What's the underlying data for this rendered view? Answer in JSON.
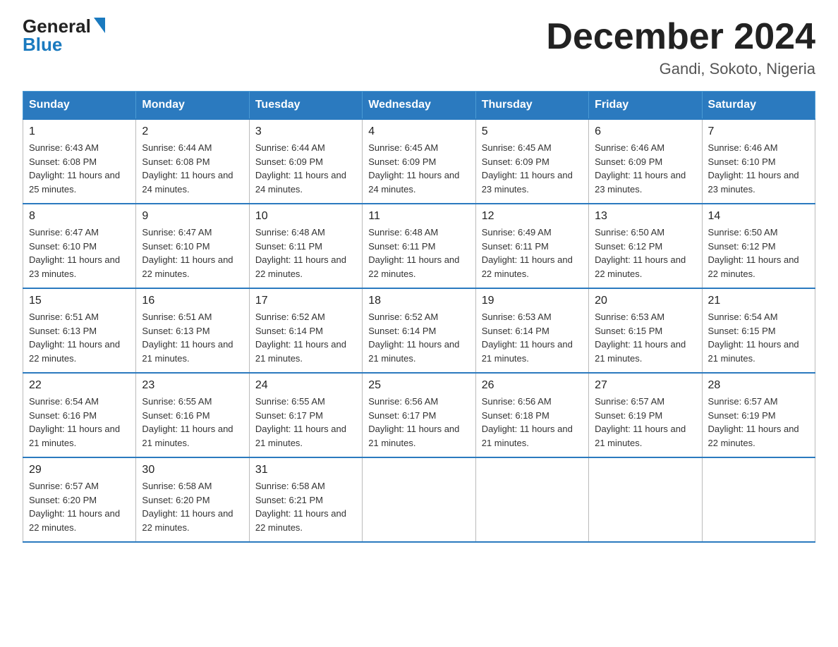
{
  "logo": {
    "general": "General",
    "blue": "Blue"
  },
  "header": {
    "month": "December 2024",
    "location": "Gandi, Sokoto, Nigeria"
  },
  "days_of_week": [
    "Sunday",
    "Monday",
    "Tuesday",
    "Wednesday",
    "Thursday",
    "Friday",
    "Saturday"
  ],
  "weeks": [
    [
      {
        "day": "1",
        "sunrise": "6:43 AM",
        "sunset": "6:08 PM",
        "daylight": "11 hours and 25 minutes."
      },
      {
        "day": "2",
        "sunrise": "6:44 AM",
        "sunset": "6:08 PM",
        "daylight": "11 hours and 24 minutes."
      },
      {
        "day": "3",
        "sunrise": "6:44 AM",
        "sunset": "6:09 PM",
        "daylight": "11 hours and 24 minutes."
      },
      {
        "day": "4",
        "sunrise": "6:45 AM",
        "sunset": "6:09 PM",
        "daylight": "11 hours and 24 minutes."
      },
      {
        "day": "5",
        "sunrise": "6:45 AM",
        "sunset": "6:09 PM",
        "daylight": "11 hours and 23 minutes."
      },
      {
        "day": "6",
        "sunrise": "6:46 AM",
        "sunset": "6:09 PM",
        "daylight": "11 hours and 23 minutes."
      },
      {
        "day": "7",
        "sunrise": "6:46 AM",
        "sunset": "6:10 PM",
        "daylight": "11 hours and 23 minutes."
      }
    ],
    [
      {
        "day": "8",
        "sunrise": "6:47 AM",
        "sunset": "6:10 PM",
        "daylight": "11 hours and 23 minutes."
      },
      {
        "day": "9",
        "sunrise": "6:47 AM",
        "sunset": "6:10 PM",
        "daylight": "11 hours and 22 minutes."
      },
      {
        "day": "10",
        "sunrise": "6:48 AM",
        "sunset": "6:11 PM",
        "daylight": "11 hours and 22 minutes."
      },
      {
        "day": "11",
        "sunrise": "6:48 AM",
        "sunset": "6:11 PM",
        "daylight": "11 hours and 22 minutes."
      },
      {
        "day": "12",
        "sunrise": "6:49 AM",
        "sunset": "6:11 PM",
        "daylight": "11 hours and 22 minutes."
      },
      {
        "day": "13",
        "sunrise": "6:50 AM",
        "sunset": "6:12 PM",
        "daylight": "11 hours and 22 minutes."
      },
      {
        "day": "14",
        "sunrise": "6:50 AM",
        "sunset": "6:12 PM",
        "daylight": "11 hours and 22 minutes."
      }
    ],
    [
      {
        "day": "15",
        "sunrise": "6:51 AM",
        "sunset": "6:13 PM",
        "daylight": "11 hours and 22 minutes."
      },
      {
        "day": "16",
        "sunrise": "6:51 AM",
        "sunset": "6:13 PM",
        "daylight": "11 hours and 21 minutes."
      },
      {
        "day": "17",
        "sunrise": "6:52 AM",
        "sunset": "6:14 PM",
        "daylight": "11 hours and 21 minutes."
      },
      {
        "day": "18",
        "sunrise": "6:52 AM",
        "sunset": "6:14 PM",
        "daylight": "11 hours and 21 minutes."
      },
      {
        "day": "19",
        "sunrise": "6:53 AM",
        "sunset": "6:14 PM",
        "daylight": "11 hours and 21 minutes."
      },
      {
        "day": "20",
        "sunrise": "6:53 AM",
        "sunset": "6:15 PM",
        "daylight": "11 hours and 21 minutes."
      },
      {
        "day": "21",
        "sunrise": "6:54 AM",
        "sunset": "6:15 PM",
        "daylight": "11 hours and 21 minutes."
      }
    ],
    [
      {
        "day": "22",
        "sunrise": "6:54 AM",
        "sunset": "6:16 PM",
        "daylight": "11 hours and 21 minutes."
      },
      {
        "day": "23",
        "sunrise": "6:55 AM",
        "sunset": "6:16 PM",
        "daylight": "11 hours and 21 minutes."
      },
      {
        "day": "24",
        "sunrise": "6:55 AM",
        "sunset": "6:17 PM",
        "daylight": "11 hours and 21 minutes."
      },
      {
        "day": "25",
        "sunrise": "6:56 AM",
        "sunset": "6:17 PM",
        "daylight": "11 hours and 21 minutes."
      },
      {
        "day": "26",
        "sunrise": "6:56 AM",
        "sunset": "6:18 PM",
        "daylight": "11 hours and 21 minutes."
      },
      {
        "day": "27",
        "sunrise": "6:57 AM",
        "sunset": "6:19 PM",
        "daylight": "11 hours and 21 minutes."
      },
      {
        "day": "28",
        "sunrise": "6:57 AM",
        "sunset": "6:19 PM",
        "daylight": "11 hours and 22 minutes."
      }
    ],
    [
      {
        "day": "29",
        "sunrise": "6:57 AM",
        "sunset": "6:20 PM",
        "daylight": "11 hours and 22 minutes."
      },
      {
        "day": "30",
        "sunrise": "6:58 AM",
        "sunset": "6:20 PM",
        "daylight": "11 hours and 22 minutes."
      },
      {
        "day": "31",
        "sunrise": "6:58 AM",
        "sunset": "6:21 PM",
        "daylight": "11 hours and 22 minutes."
      },
      null,
      null,
      null,
      null
    ]
  ],
  "labels": {
    "sunrise": "Sunrise:",
    "sunset": "Sunset:",
    "daylight": "Daylight:"
  }
}
